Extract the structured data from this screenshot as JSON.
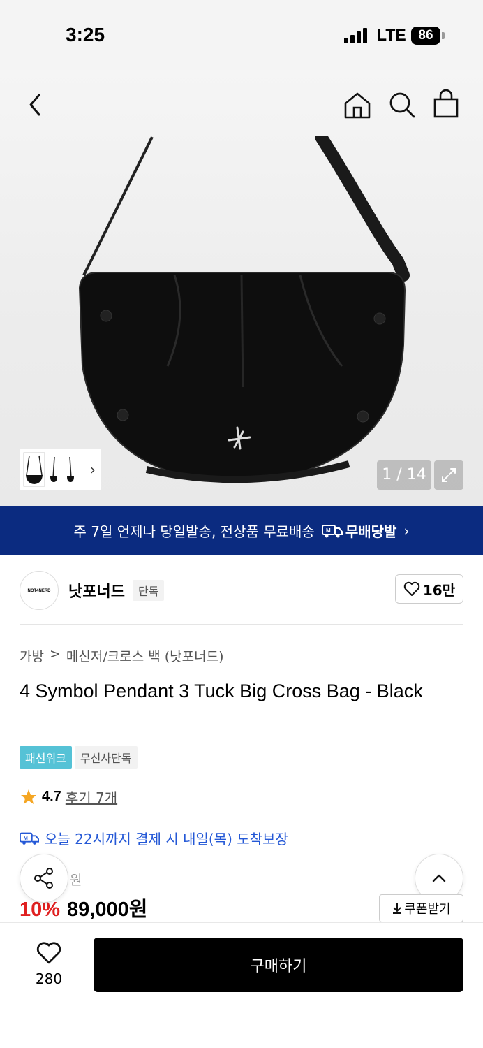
{
  "status_bar": {
    "time": "3:25",
    "network": "LTE",
    "battery": "86"
  },
  "nav": {
    "icons": [
      "back-icon",
      "home-icon",
      "search-icon",
      "shopping-bag-icon"
    ]
  },
  "gallery": {
    "counter": "1 / 14",
    "thumbnail_count": 3
  },
  "banner": {
    "text": "주 7일 언제나 당일발송, 전상품 무료배송",
    "badge": "무배당발",
    "chevron": "›"
  },
  "brand": {
    "logo_text": "NOT4NERD",
    "name": "낫포너드",
    "tag": "단독",
    "likes": "16만"
  },
  "breadcrumb": {
    "category": "가방",
    "separator": ">",
    "subcategory": "메신저/크로스 백 (낫포너드)"
  },
  "product": {
    "title": "4 Symbol Pendant 3 Tuck Big Cross Bag - Black",
    "tags": [
      "패션위크",
      "무신사단독"
    ],
    "rating": "4.7",
    "reviews": "후기 7개",
    "delivery": "오늘 22시까지 결제 시 내일(목) 도착보장",
    "original_price": "원",
    "discount": "10%",
    "price": "89,000원"
  },
  "actions": {
    "coupon": "쿠폰받기",
    "wish_count": "280",
    "buy": "구매하기"
  },
  "colors": {
    "banner": "#0b2b80",
    "discount": "#e02020",
    "delivery": "#2458d6",
    "tag_cyan": "#55c2d6"
  }
}
